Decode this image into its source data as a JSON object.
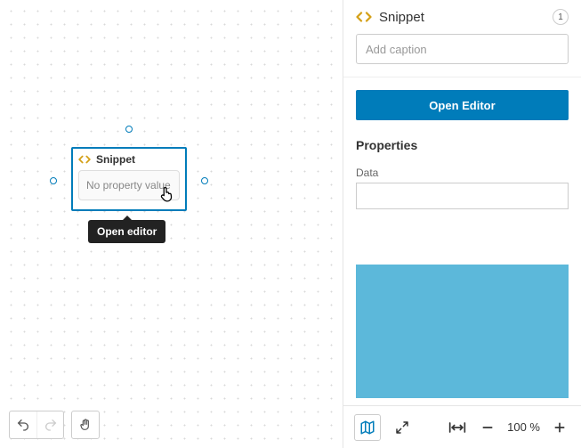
{
  "canvas": {
    "node": {
      "title": "Snippet",
      "placeholder": "No property value"
    },
    "tooltip": "Open editor"
  },
  "panel": {
    "title": "Snippet",
    "count": "1",
    "caption_placeholder": "Add caption",
    "open_editor_label": "Open Editor",
    "properties_title": "Properties",
    "data_label": "Data",
    "data_value": ""
  },
  "toolbar": {
    "zoom": "100 %"
  }
}
